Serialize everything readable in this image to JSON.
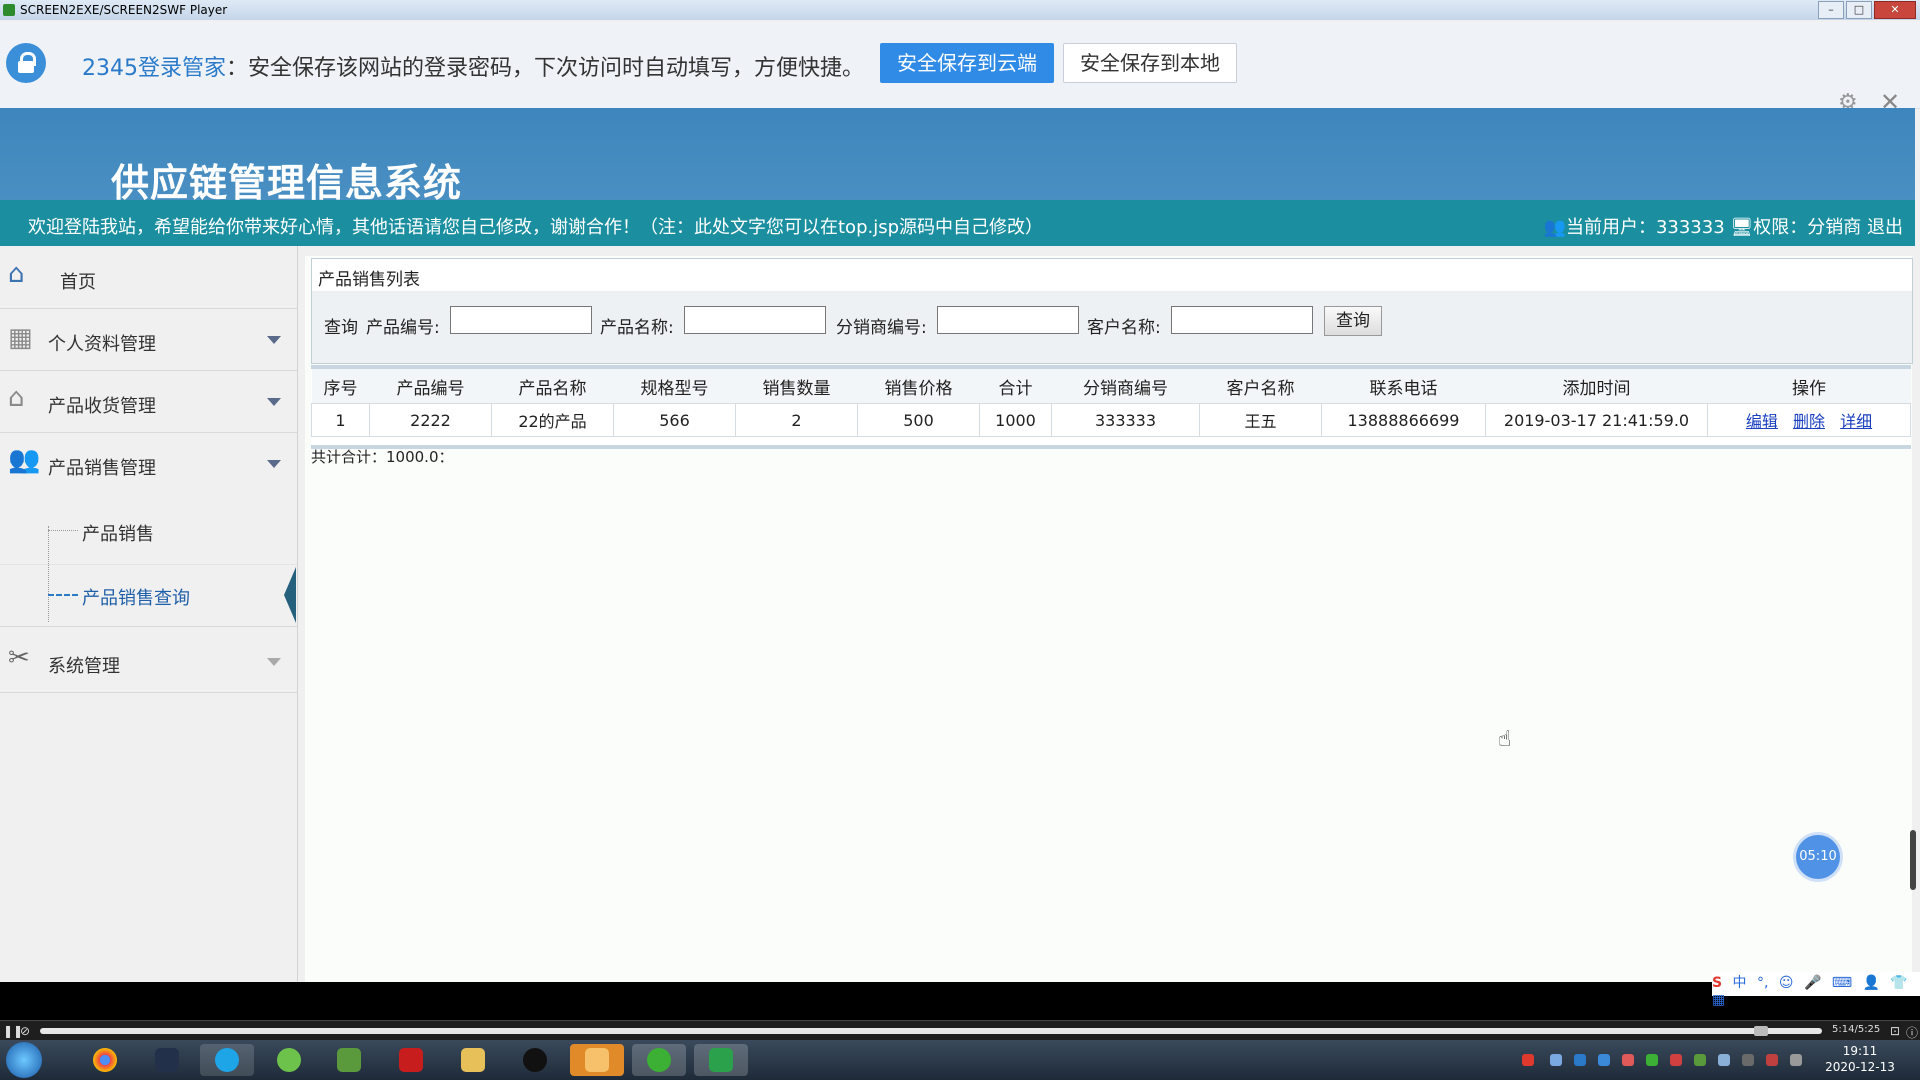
{
  "player": {
    "window_title": "SCREEN2EXE/SCREEN2SWF Player",
    "btn_min": "–",
    "btn_max": "□",
    "btn_close": "✕",
    "progress_time": "5:14/5:25",
    "progress_fraction": 0.966
  },
  "password_bar": {
    "brand": "2345登录管家",
    "message": "：安全保存该网站的登录密码，下次访问时自动填写，方便快捷。",
    "save_cloud": "安全保存到云端",
    "save_local": "安全保存到本地"
  },
  "app": {
    "title": "供应链管理信息系统",
    "welcome": "欢迎登陆我站，希望能给你带来好心情，其他话语请您自己修改，谢谢合作！（注：此处文字您可以在top.jsp源码中自己修改）",
    "current_user_label": "当前用户：333333",
    "role_label": "权限：分销商",
    "logout": "退出"
  },
  "sidebar": {
    "home": "首页",
    "menus": [
      {
        "label": "个人资料管理"
      },
      {
        "label": "产品收货管理"
      },
      {
        "label": "产品销售管理"
      },
      {
        "label": "系统管理"
      }
    ],
    "subitems": [
      {
        "label": "产品销售"
      },
      {
        "label": "产品销售查询"
      }
    ]
  },
  "panel": {
    "title": "产品销售列表"
  },
  "search": {
    "query": "查询",
    "product_code_label": "产品编号:",
    "product_name_label": "产品名称:",
    "distributor_code_label": "分销商编号:",
    "customer_name_label": "客户名称:",
    "button": "查询"
  },
  "table": {
    "headers": [
      "序号",
      "产品编号",
      "产品名称",
      "规格型号",
      "销售数量",
      "销售价格",
      "合计",
      "分销商编号",
      "客户名称",
      "联系电话",
      "添加时间",
      "操作"
    ],
    "rows": [
      {
        "no": "1",
        "code": "2222",
        "name": "22的产品",
        "spec": "566",
        "qty": "2",
        "price": "500",
        "sum": "1000",
        "distributor": "333333",
        "customer": "王五",
        "phone": "13888866699",
        "time": "2019-03-17 21:41:59.0",
        "edit": "编辑",
        "delete": "删除",
        "detail": "详细"
      }
    ]
  },
  "total": "共计合计：1000.0：",
  "timer": "05:10",
  "ime": {
    "lang": "中"
  },
  "taskbar": {
    "time": "19:11",
    "date": "2020-12-13"
  }
}
